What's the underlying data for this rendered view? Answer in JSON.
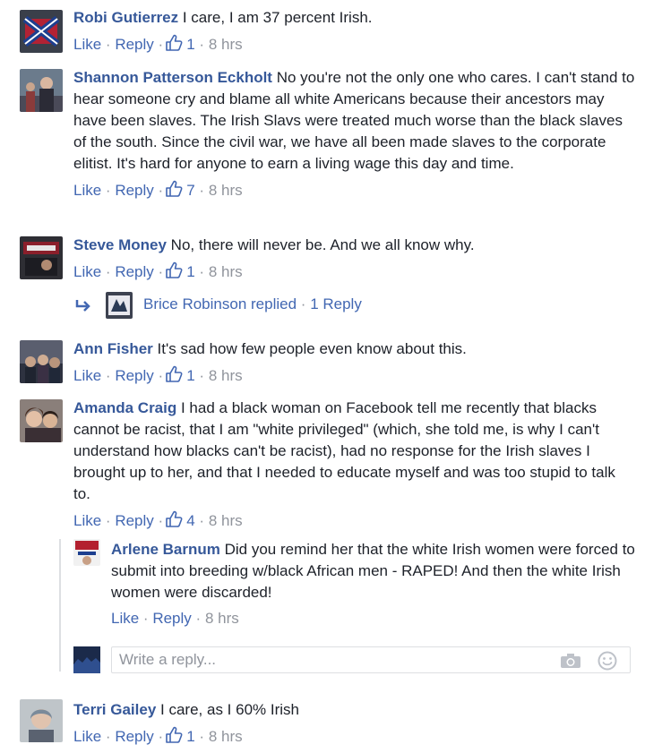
{
  "labels": {
    "like": "Like",
    "reply": "Reply",
    "dot": "·"
  },
  "comments": [
    {
      "name": "Robi Gutierrez",
      "text": "I care, I am 37 percent Irish.",
      "likes": "1",
      "time": "8 hrs"
    },
    {
      "name": "Shannon Patterson Eckholt",
      "text": "No you're not the only one who cares. I can't stand to hear someone cry and blame all white Americans because their ancestors may have been slaves. The Irish Slavs were treated much worse than the black slaves of the south. Since the civil war, we have all been made slaves to the corporate elitist. It's hard for anyone to earn a living wage this day and time.",
      "likes": "7",
      "time": "8 hrs"
    },
    {
      "name": "Steve Money",
      "text": "No, there will never be. And we all know why.",
      "likes": "1",
      "time": "8 hrs"
    },
    {
      "name": "Ann Fisher",
      "text": "It's sad how few people even know about this.",
      "likes": "1",
      "time": "8 hrs"
    },
    {
      "name": "Amanda Craig",
      "text": "I had a black woman on Facebook tell me recently that blacks cannot be racist, that I am \"white privileged\" (which, she told me, is why I can't understand how blacks can't be racist), had no response for the Irish slaves I brought up to her, and that I needed to educate myself and was too stupid to talk to.",
      "likes": "4",
      "time": "8 hrs"
    },
    {
      "name": "Terri Gailey",
      "text": "I care, as I 60% Irish",
      "likes": "1",
      "time": "8 hrs"
    }
  ],
  "replied_summary": {
    "text": "Brice Robinson replied",
    "count": "1 Reply"
  },
  "reply": {
    "name": "Arlene Barnum",
    "text": "Did you remind her that the white Irish women were forced to submit into breeding w/black African men - RAPED! And then the white Irish women were discarded!",
    "time": "8 hrs"
  },
  "write_reply": {
    "placeholder": "Write a reply..."
  },
  "colors": {
    "name": "#365899",
    "link": "#4267b2",
    "meta": "#90949c",
    "text": "#1d2129"
  }
}
